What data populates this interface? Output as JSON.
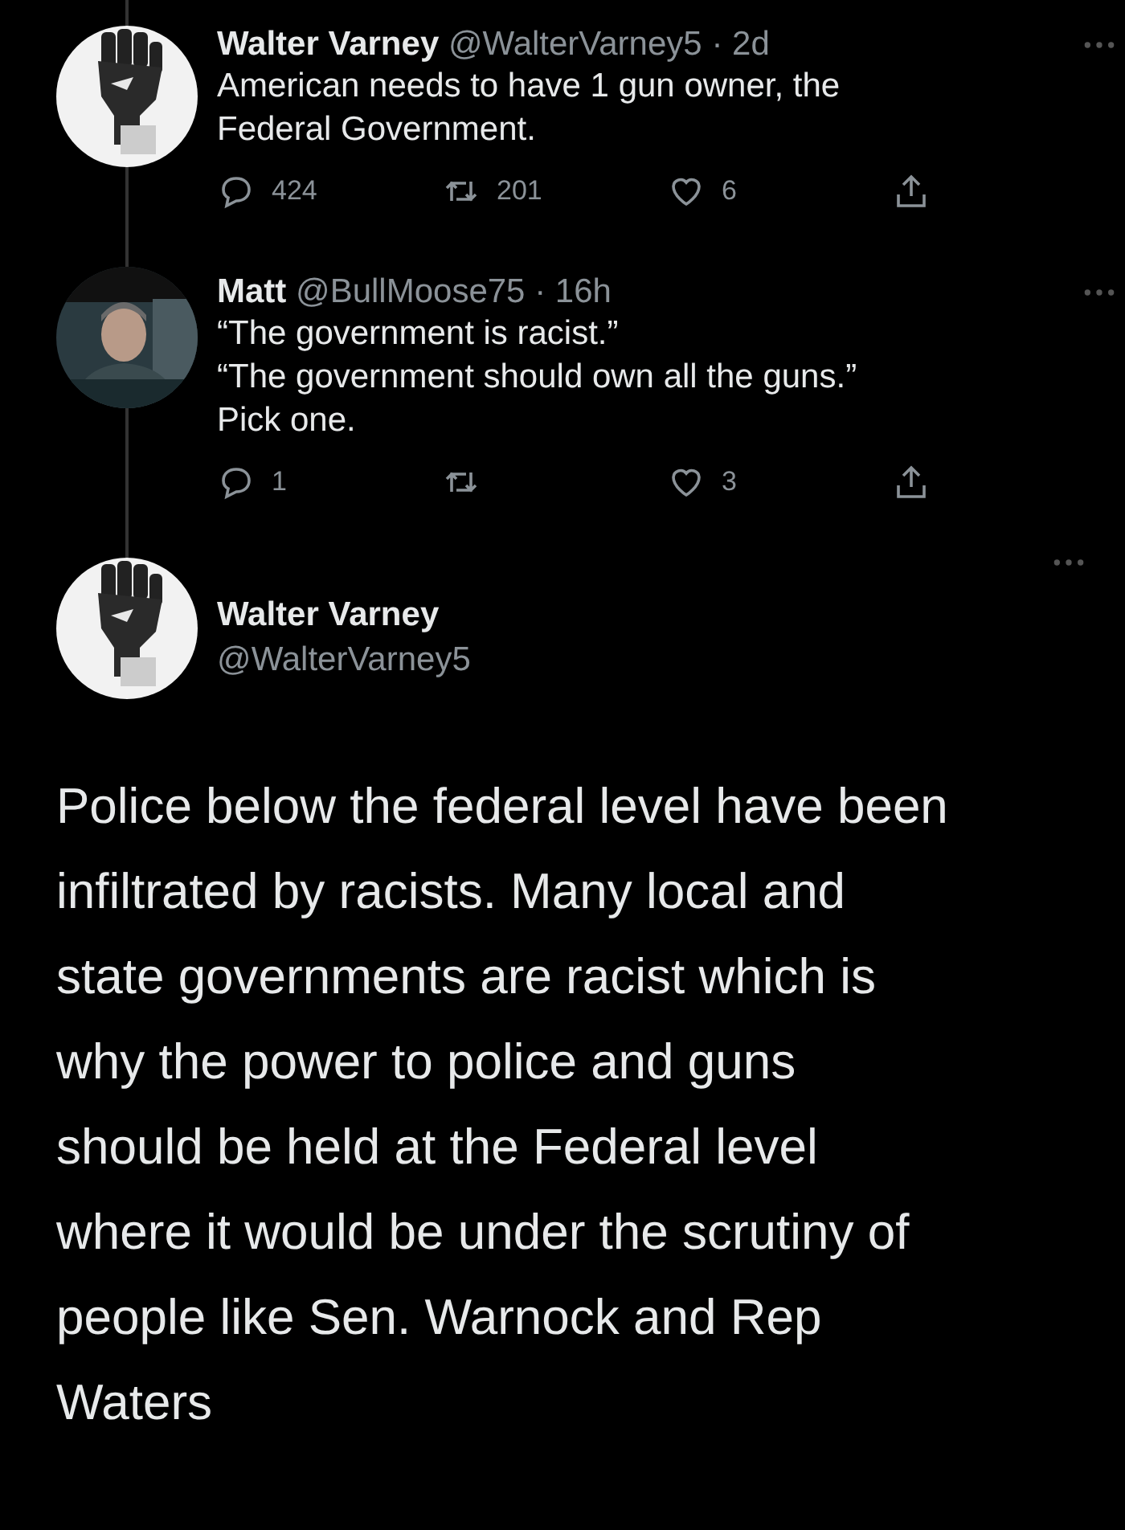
{
  "replies": [
    {
      "avatar": {
        "kind": "picture"
      },
      "name": "Walter Varney",
      "handle": "@WalterVarney5",
      "time": "· 2d",
      "lines": [
        "American needs to have 1 gun owner, the",
        "Federal Government."
      ],
      "replies": "424",
      "retweets": "201",
      "likes": "6"
    },
    {
      "avatar": {
        "kind": "picture"
      },
      "name": "Matt",
      "handle": "@BullMoose75",
      "time": "· 16h",
      "lines": [
        "“The government is racist.”",
        "“The government should own all the guns.”",
        "Pick one."
      ],
      "replies": "1",
      "likes": "3"
    }
  ],
  "main": {
    "avatar": {
      "kind": "picture"
    },
    "name": "Walter Varney",
    "handle": "@WalterVarney5",
    "lines": [
      "Police below the federal level have been",
      "infiltrated by racists. Many local and",
      "state governments are racist which is",
      "why the power to police and guns",
      "should be held at the Federal level",
      "where it would be under the scrutiny of",
      "people like Sen. Warnock and Rep",
      "Waters"
    ]
  }
}
